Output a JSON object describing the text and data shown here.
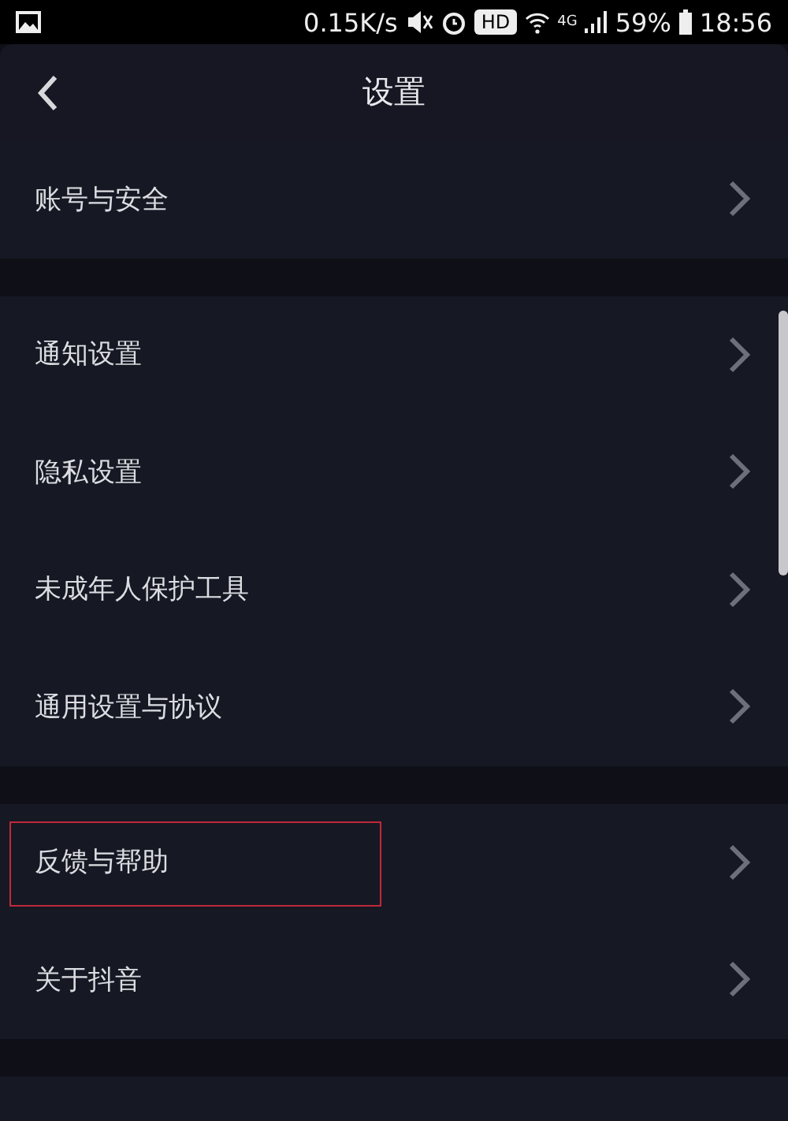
{
  "status_bar": {
    "speed": "0.15K/s",
    "hd": "HD",
    "network": "4G",
    "battery": "59%",
    "time": "18:56"
  },
  "header": {
    "title": "设置"
  },
  "sections": [
    {
      "items": [
        {
          "label": "账号与安全",
          "highlighted": false
        }
      ]
    },
    {
      "items": [
        {
          "label": "通知设置",
          "highlighted": false
        },
        {
          "label": "隐私设置",
          "highlighted": false
        },
        {
          "label": "未成年人保护工具",
          "highlighted": false
        },
        {
          "label": "通用设置与协议",
          "highlighted": false
        }
      ]
    },
    {
      "items": [
        {
          "label": "反馈与帮助",
          "highlighted": true
        },
        {
          "label": "关于抖音",
          "highlighted": false
        }
      ]
    }
  ]
}
